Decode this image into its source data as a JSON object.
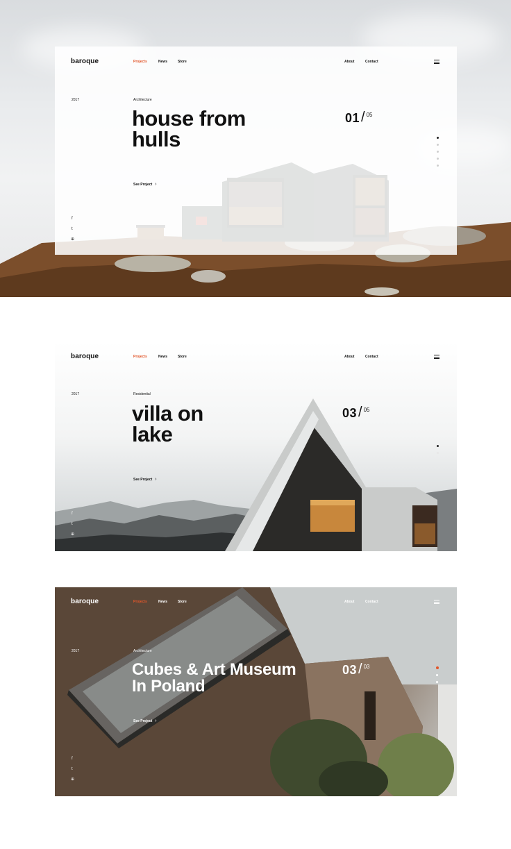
{
  "brand": "baroque",
  "nav": {
    "projects": "Projects",
    "news": "News",
    "store": "Store",
    "about": "About",
    "contact": "Contact"
  },
  "social_icons": [
    "facebook-icon",
    "twitter-icon",
    "dribbble-icon"
  ],
  "colors": {
    "accent": "#e2562a",
    "text": "#111111",
    "light_text": "#ffffff"
  },
  "slides": [
    {
      "year": "2017",
      "category": "Architecture",
      "title_line1": "house from",
      "title_line2": "hulls",
      "cta": "See Project",
      "chevron": "›",
      "current": "01",
      "total": "05"
    },
    {
      "year": "2017",
      "category": "Residential",
      "title_line1": "villa on",
      "title_line2": "lake",
      "cta": "See Project",
      "chevron": "›",
      "current": "03",
      "total": "05"
    },
    {
      "year": "2017",
      "category": "Architecture",
      "title_line1": "Cubes & Art Museum",
      "title_line2": "In Poland",
      "cta": "See Project",
      "chevron": "›",
      "current": "03",
      "total": "03"
    }
  ],
  "glyphs": {
    "slash": "/",
    "facebook": "f",
    "twitter": "t",
    "dribbble": "⊕"
  }
}
